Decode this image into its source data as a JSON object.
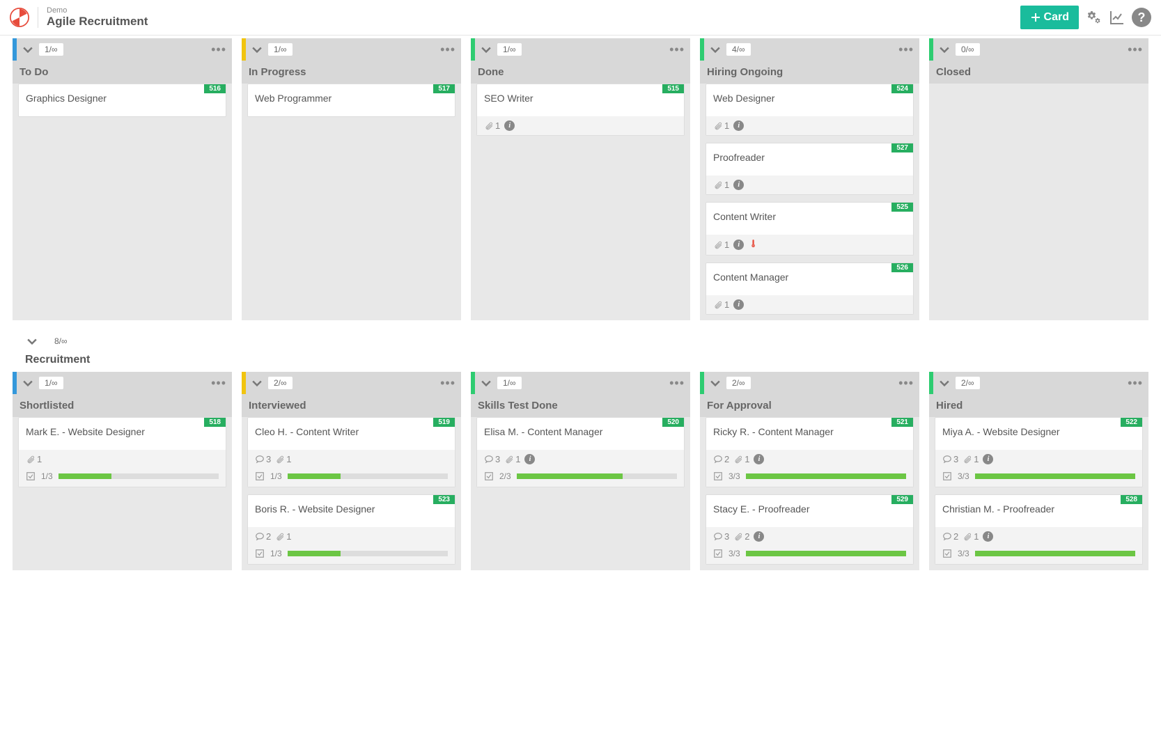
{
  "header": {
    "demo_label": "Demo",
    "board_title": "Agile Recruitment",
    "card_button": "Card"
  },
  "swimlane": {
    "wip": "8/∞",
    "title": "Recruitment"
  },
  "top_columns": [
    {
      "stripe": "blue",
      "wip": "1/∞",
      "title": "To Do",
      "cards": [
        {
          "id": "516",
          "title": "Graphics Designer"
        }
      ]
    },
    {
      "stripe": "yellow",
      "wip": "1/∞",
      "title": "In Progress",
      "cards": [
        {
          "id": "517",
          "title": "Web Programmer"
        }
      ]
    },
    {
      "stripe": "green",
      "wip": "1/∞",
      "title": "Done",
      "cards": [
        {
          "id": "515",
          "title": "SEO Writer",
          "attach": 1,
          "info": true
        }
      ]
    },
    {
      "stripe": "green",
      "wip": "4/∞",
      "title": "Hiring Ongoing",
      "cards": [
        {
          "id": "524",
          "title": "Web Designer",
          "attach": 1,
          "info": true
        },
        {
          "id": "527",
          "title": "Proofreader",
          "attach": 1,
          "info": true
        },
        {
          "id": "525",
          "title": "Content Writer",
          "attach": 1,
          "info": true,
          "thermo": true
        },
        {
          "id": "526",
          "title": "Content Manager",
          "attach": 1,
          "info": true
        }
      ]
    },
    {
      "stripe": "green",
      "wip": "0/∞",
      "title": "Closed",
      "cards": []
    }
  ],
  "bottom_columns": [
    {
      "stripe": "blue",
      "wip": "1/∞",
      "title": "Shortlisted",
      "cards": [
        {
          "id": "518",
          "title": "Mark E. - Website Designer",
          "attach": 1,
          "progress": "1/3",
          "pct": 33
        }
      ]
    },
    {
      "stripe": "yellow",
      "wip": "2/∞",
      "title": "Interviewed",
      "cards": [
        {
          "id": "519",
          "title": "Cleo H. - Content Writer",
          "comments": 3,
          "attach": 1,
          "progress": "1/3",
          "pct": 33
        },
        {
          "id": "523",
          "title": "Boris R. - Website Designer",
          "comments": 2,
          "attach": 1,
          "progress": "1/3",
          "pct": 33
        }
      ]
    },
    {
      "stripe": "green",
      "wip": "1/∞",
      "title": "Skills Test Done",
      "cards": [
        {
          "id": "520",
          "title": "Elisa M. - Content Manager",
          "comments": 3,
          "attach": 1,
          "info": true,
          "progress": "2/3",
          "pct": 66
        }
      ]
    },
    {
      "stripe": "green",
      "wip": "2/∞",
      "title": "For Approval",
      "cards": [
        {
          "id": "521",
          "title": "Ricky R. - Content Manager",
          "comments": 2,
          "attach": 1,
          "info": true,
          "progress": "3/3",
          "pct": 100
        },
        {
          "id": "529",
          "title": "Stacy E. - Proofreader",
          "comments": 3,
          "attach": 2,
          "info": true,
          "progress": "3/3",
          "pct": 100
        }
      ]
    },
    {
      "stripe": "green",
      "wip": "2/∞",
      "title": "Hired",
      "cards": [
        {
          "id": "522",
          "title": "Miya A. - Website Designer",
          "comments": 3,
          "attach": 1,
          "info": true,
          "progress": "3/3",
          "pct": 100
        },
        {
          "id": "528",
          "title": "Christian M. - Proofreader",
          "comments": 2,
          "attach": 1,
          "info": true,
          "progress": "3/3",
          "pct": 100
        }
      ]
    }
  ]
}
